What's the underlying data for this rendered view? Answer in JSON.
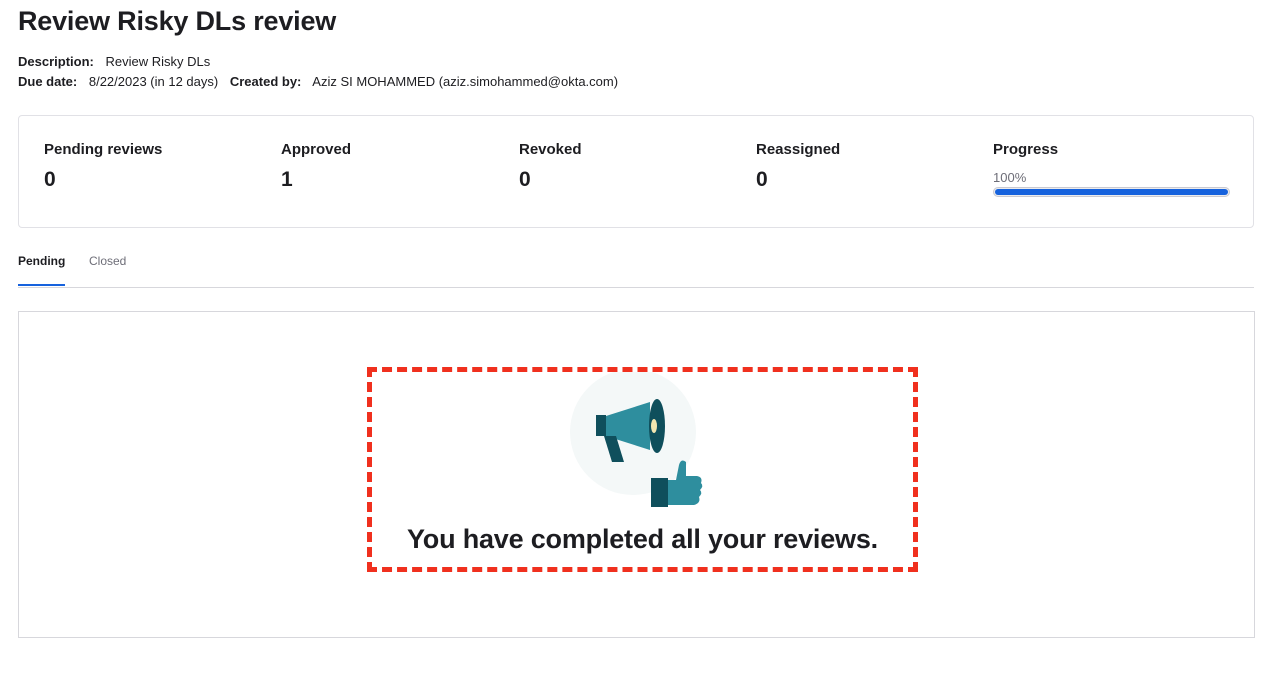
{
  "header": {
    "title": "Review Risky DLs review",
    "description_label": "Description:",
    "description_value": "Review Risky DLs",
    "due_date_label": "Due date:",
    "due_date_value": "8/22/2023 (in 12 days)",
    "created_by_label": "Created by:",
    "created_by_value": "Aziz SI MOHAMMED (aziz.simohammed@okta.com)"
  },
  "stats": {
    "pending_label": "Pending reviews",
    "pending_value": "0",
    "approved_label": "Approved",
    "approved_value": "1",
    "revoked_label": "Revoked",
    "revoked_value": "0",
    "reassigned_label": "Reassigned",
    "reassigned_value": "0",
    "progress_label": "Progress",
    "progress_text": "100%",
    "progress_fraction": 1.0
  },
  "tabs": [
    {
      "label": "Pending",
      "active": true
    },
    {
      "label": "Closed",
      "active": false
    }
  ],
  "empty_state": {
    "message": "You have completed all your reviews.",
    "icon": "megaphone-thumbs-up-icon"
  },
  "colors": {
    "accent": "#1662dd",
    "highlight": "#f0301e",
    "illustration_teal": "#2e8e9e",
    "illustration_dark": "#0f4f5c"
  }
}
